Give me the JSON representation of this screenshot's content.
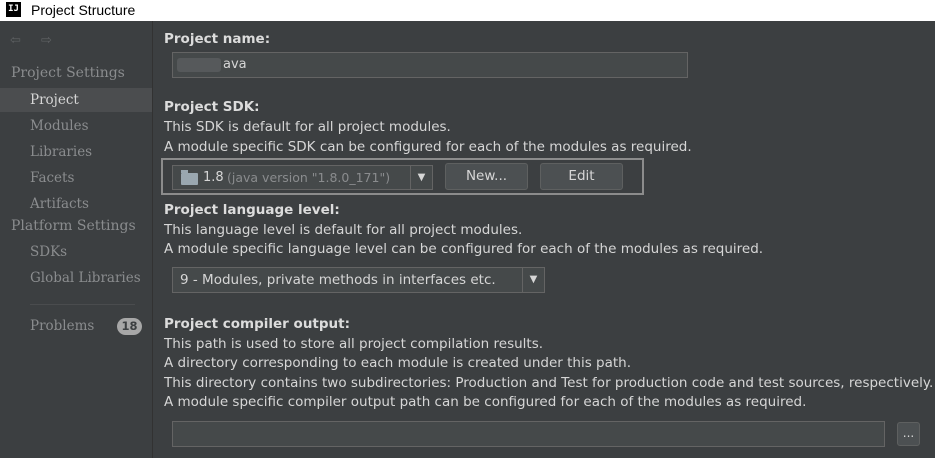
{
  "window": {
    "title": "Project Structure",
    "icon": "intellij-icon"
  },
  "sidebar": {
    "nav_arrows": "⇦ ⇨",
    "project_settings_header": "Project Settings",
    "project_items": [
      {
        "label": "Project",
        "selected": true
      },
      {
        "label": "Modules"
      },
      {
        "label": "Libraries"
      },
      {
        "label": "Facets"
      },
      {
        "label": "Artifacts"
      }
    ],
    "platform_settings_header": "Platform Settings",
    "platform_items": [
      {
        "label": "SDKs"
      },
      {
        "label": "Global Libraries"
      }
    ],
    "problems": {
      "label": "Problems",
      "count": "18"
    }
  },
  "project_name": {
    "label": "Project name:",
    "value": "ava"
  },
  "project_sdk": {
    "label": "Project SDK:",
    "line1": "This SDK is default for all project modules.",
    "line2": "A module specific SDK can be configured for each of the modules as required.",
    "sdk_version": "1.8",
    "sdk_detail": "(java version \"1.8.0_171\")",
    "new_button": "New...",
    "edit_button": "Edit"
  },
  "language_level": {
    "label": "Project language level:",
    "line1": "This language level is default for all project modules.",
    "line2": "A module specific language level can be configured for each of the modules as required.",
    "selected": "9 - Modules, private methods in interfaces etc."
  },
  "compiler_output": {
    "label": "Project compiler output:",
    "line1": "This path is used to store all project compilation results.",
    "line2": "A directory corresponding to each module is created under this path.",
    "line3": "This directory contains two subdirectories: Production and Test for production code and test sources, respectively.",
    "line4": "A module specific compiler output path can be configured for each of the modules as required.",
    "path_value": "",
    "browse_button": "..."
  },
  "colors": {
    "background": "#3c3f41",
    "selection": "#4b4d4f",
    "text": "#d6d6d6",
    "muted": "#8a8c8e"
  }
}
